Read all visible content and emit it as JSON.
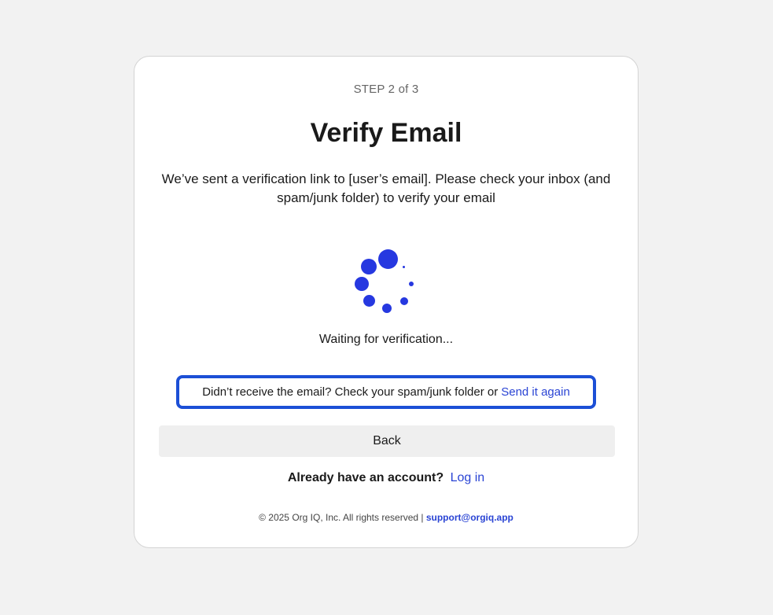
{
  "step_label": "STEP 2 of 3",
  "title": "Verify Email",
  "description": "We’ve sent a verification link to [user’s email]. Please check your inbox (and spam/junk folder) to verify your email",
  "spinner_icon": "loading-spinner-icon",
  "waiting_text": "Waiting for verification...",
  "resend": {
    "prompt": "Didn’t receive the email? Check your spam/junk folder or",
    "link": "Send it again"
  },
  "back_button": "Back",
  "account": {
    "prompt": "Already have an account?",
    "link": "Log in"
  },
  "footer": {
    "copyright": "© 2025 Org IQ, Inc. All rights reserved |",
    "support_email": "support@orgiq.app"
  },
  "colors": {
    "accent": "#2638e0",
    "focus_border": "#1c4fd6",
    "link": "#2a44d4",
    "background": "#f2f2f2",
    "button_bg": "#efefef"
  }
}
